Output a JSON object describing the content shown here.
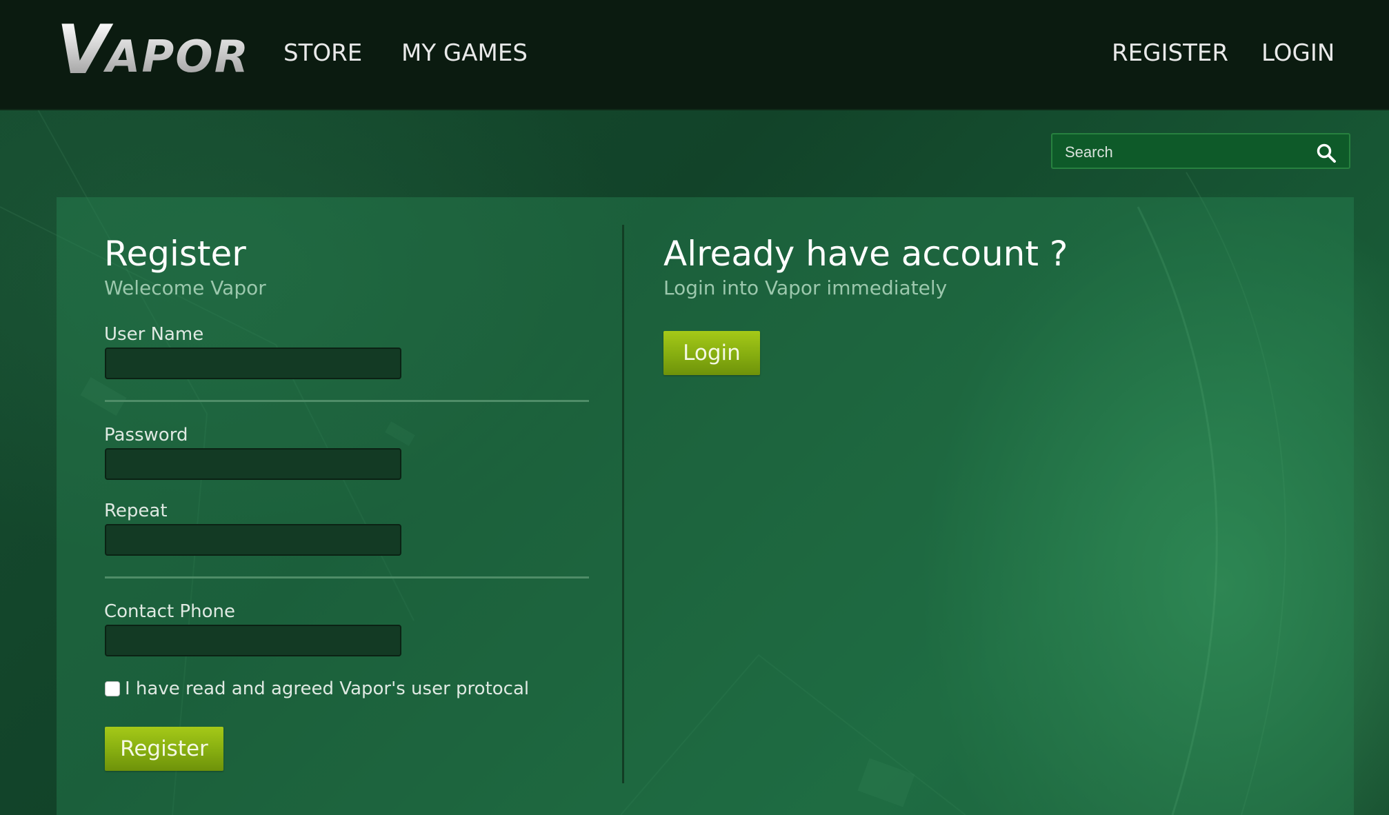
{
  "nav": {
    "logo_first": "V",
    "logo_rest": "APOR",
    "store": "STORE",
    "my_games": "MY GAMES",
    "register": "REGISTER",
    "login": "LOGIN"
  },
  "search": {
    "placeholder": "Search",
    "icon": "search-icon"
  },
  "register": {
    "title": "Register",
    "subtitle": "Welecome Vapor",
    "username_label": "User Name",
    "username_value": "",
    "password_label": "Password",
    "password_value": "",
    "repeat_label": "Repeat",
    "repeat_value": "",
    "phone_label": "Contact Phone",
    "phone_value": "",
    "agreement_label": "I have read and agreed Vapor's user protocal",
    "agreement_checked": false,
    "button_label": "Register"
  },
  "login_section": {
    "title": "Already have account ?",
    "subtitle": "Login into Vapor immediately",
    "button_label": "Login"
  },
  "colors": {
    "accent_button": "#8fb812",
    "topbar": "#0b1b10",
    "background": "#14482b"
  }
}
